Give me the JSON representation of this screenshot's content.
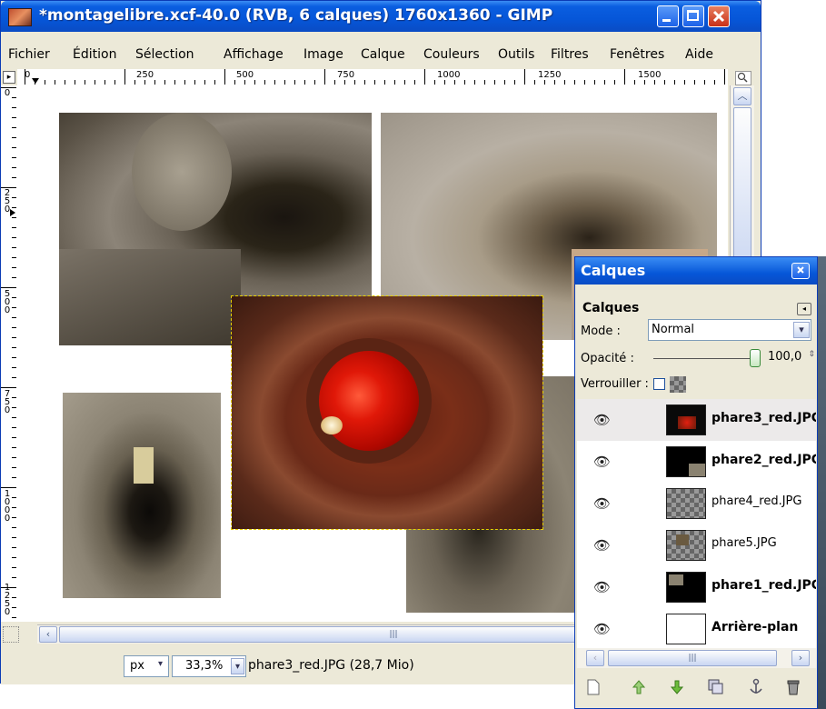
{
  "window": {
    "title": "*montagelibre.xcf-40.0 (RVB, 6 calques) 1760x1360 - GIMP"
  },
  "menu": [
    "Fichier",
    "Édition",
    "Sélection",
    "Affichage",
    "Image",
    "Calque",
    "Couleurs",
    "Outils",
    "Filtres",
    "Fenêtres",
    "Aide"
  ],
  "ruler_top": [
    "0",
    "250",
    "500",
    "750",
    "1000",
    "1250",
    "1500"
  ],
  "ruler_left": [
    "0",
    "250",
    "500",
    "750",
    "1000",
    "1250"
  ],
  "statusbar": {
    "unit": "px",
    "zoom": "33,3%",
    "info": "phare3_red.JPG (28,7 Mio)"
  },
  "layers_dialog": {
    "title": "Calques",
    "tab_label": "Calques",
    "mode_label": "Mode :",
    "mode_value": "Normal",
    "opacity_label": "Opacité :",
    "opacity_value": "100,0",
    "opacity_fraction": 1.0,
    "lock_label": "Verrouiller :",
    "layers": [
      {
        "name": "phare3_red.JPG",
        "selected": true,
        "bold": true
      },
      {
        "name": "phare2_red.JPG",
        "selected": false,
        "bold": true
      },
      {
        "name": "phare4_red.JPG",
        "selected": false,
        "bold": false
      },
      {
        "name": "phare5.JPG",
        "selected": false,
        "bold": false
      },
      {
        "name": "phare1_red.JPG",
        "selected": false,
        "bold": true
      },
      {
        "name": "Arrière-plan",
        "selected": false,
        "bold": true
      }
    ]
  },
  "colors": {
    "title_bar": "#0656d8",
    "selection_dash": "#e8d000",
    "close_red": "#c83018"
  }
}
